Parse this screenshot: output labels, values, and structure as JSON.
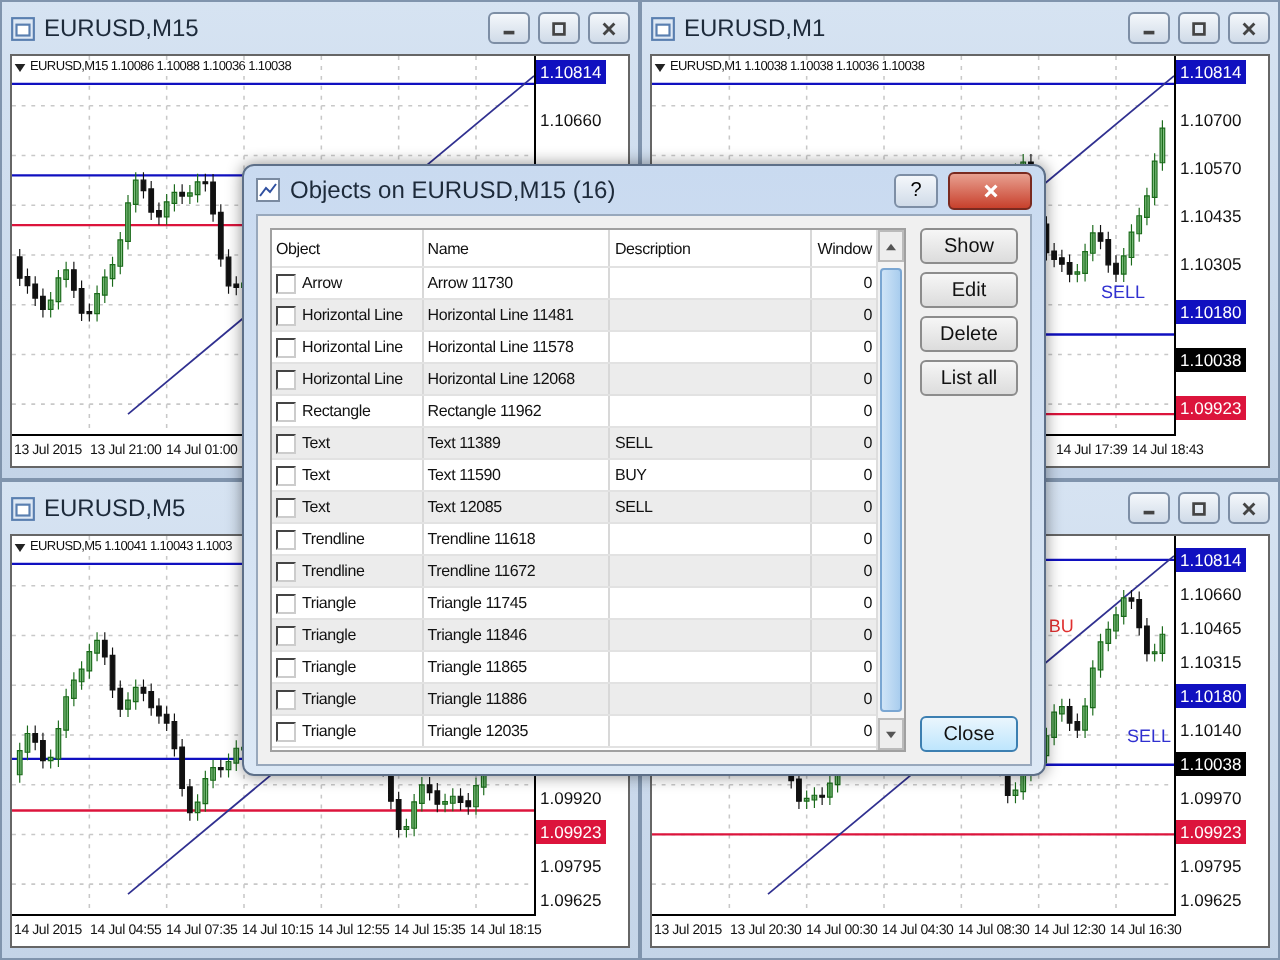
{
  "charts": [
    {
      "title": "EURUSD,M15",
      "header": "EURUSD,M15  1.10086 1.10088 1.10036 1.10038",
      "price_labels": [
        {
          "text": "1.10814",
          "kind": "tag",
          "color": "#1010c0"
        },
        {
          "text": "1.10660",
          "kind": "plain"
        }
      ],
      "time_labels": [
        "13 Jul 2015",
        "13 Jul 21:00",
        "14 Jul 01:00"
      ]
    },
    {
      "title": "EURUSD,M1",
      "header": "EURUSD,M1  1.10038 1.10038 1.10036 1.10038",
      "price_labels": [
        {
          "text": "1.10814",
          "kind": "tag",
          "color": "#1010c0"
        },
        {
          "text": "1.10700",
          "kind": "plain"
        },
        {
          "text": "1.10570",
          "kind": "plain"
        },
        {
          "text": "1.10435",
          "kind": "plain"
        },
        {
          "text": "1.10305",
          "kind": "plain"
        },
        {
          "text": "1.10180",
          "kind": "tag",
          "color": "#1010c0"
        },
        {
          "text": "1.10038",
          "kind": "tag",
          "color": "#000000"
        },
        {
          "text": "1.09923",
          "kind": "tag",
          "color": "#dc143c"
        }
      ],
      "time_labels": [
        "14 Jul 17:39",
        "14 Jul 18:43"
      ],
      "marks": [
        {
          "text": "SELL",
          "color": "#3030d0"
        }
      ]
    },
    {
      "title": "EURUSD,M5",
      "header": "EURUSD,M5  1.10041 1.10043 1.1003",
      "price_labels": [
        {
          "text": "1.09920",
          "kind": "plain"
        },
        {
          "text": "1.09923",
          "kind": "tag",
          "color": "#dc143c"
        },
        {
          "text": "1.09795",
          "kind": "plain"
        },
        {
          "text": "1.09625",
          "kind": "plain"
        }
      ],
      "time_labels": [
        "14 Jul 2015",
        "14 Jul 04:55",
        "14 Jul 07:35",
        "14 Jul 10:15",
        "14 Jul 12:55",
        "14 Jul 15:35",
        "14 Jul 18:15"
      ]
    },
    {
      "price_labels": [
        {
          "text": "1.10814",
          "kind": "tag",
          "color": "#1010c0"
        },
        {
          "text": "1.10660",
          "kind": "plain"
        },
        {
          "text": "1.10465",
          "kind": "plain"
        },
        {
          "text": "1.10315",
          "kind": "plain"
        },
        {
          "text": "1.10180",
          "kind": "tag",
          "color": "#1010c0"
        },
        {
          "text": "1.10140",
          "kind": "plain"
        },
        {
          "text": "1.10038",
          "kind": "tag",
          "color": "#000000"
        },
        {
          "text": "1.09970",
          "kind": "plain"
        },
        {
          "text": "1.09923",
          "kind": "tag",
          "color": "#dc143c"
        },
        {
          "text": "1.09795",
          "kind": "plain"
        },
        {
          "text": "1.09625",
          "kind": "plain"
        }
      ],
      "time_labels": [
        "13 Jul 2015",
        "13 Jul 20:30",
        "14 Jul 00:30",
        "14 Jul 04:30",
        "14 Jul 08:30",
        "14 Jul 12:30",
        "14 Jul 16:30"
      ],
      "marks": [
        {
          "text": "BU",
          "color": "#e03030"
        },
        {
          "text": "SELL",
          "color": "#3030d0"
        }
      ]
    }
  ],
  "dialog": {
    "title": "Objects on EURUSD,M15 (16)",
    "help": "?",
    "columns": [
      "Object",
      "Name",
      "Description",
      "Window"
    ],
    "rows": [
      {
        "object": "Arrow",
        "name": "Arrow 11730",
        "description": "",
        "window": "0",
        "checked": false
      },
      {
        "object": "Horizontal Line",
        "name": "Horizontal Line 11481",
        "description": "",
        "window": "0",
        "checked": false
      },
      {
        "object": "Horizontal Line",
        "name": "Horizontal Line 11578",
        "description": "",
        "window": "0",
        "checked": false
      },
      {
        "object": "Horizontal Line",
        "name": "Horizontal Line 12068",
        "description": "",
        "window": "0",
        "checked": false
      },
      {
        "object": "Rectangle",
        "name": "Rectangle 11962",
        "description": "",
        "window": "0",
        "checked": false
      },
      {
        "object": "Text",
        "name": "Text 11389",
        "description": "SELL",
        "window": "0",
        "checked": false
      },
      {
        "object": "Text",
        "name": "Text 11590",
        "description": "BUY",
        "window": "0",
        "checked": false
      },
      {
        "object": "Text",
        "name": "Text 12085",
        "description": "SELL",
        "window": "0",
        "checked": false
      },
      {
        "object": "Trendline",
        "name": "Trendline 11618",
        "description": "",
        "window": "0",
        "checked": false
      },
      {
        "object": "Trendline",
        "name": "Trendline 11672",
        "description": "",
        "window": "0",
        "checked": false
      },
      {
        "object": "Triangle",
        "name": "Triangle 11745",
        "description": "",
        "window": "0",
        "checked": false
      },
      {
        "object": "Triangle",
        "name": "Triangle 11846",
        "description": "",
        "window": "0",
        "checked": false
      },
      {
        "object": "Triangle",
        "name": "Triangle 11865",
        "description": "",
        "window": "0",
        "checked": false
      },
      {
        "object": "Triangle",
        "name": "Triangle 11886",
        "description": "",
        "window": "0",
        "checked": false
      },
      {
        "object": "Triangle",
        "name": "Triangle 12035",
        "description": "",
        "window": "0",
        "checked": false
      }
    ],
    "buttons": [
      "Show",
      "Edit",
      "Delete",
      "List all"
    ],
    "close_button": "Close"
  }
}
